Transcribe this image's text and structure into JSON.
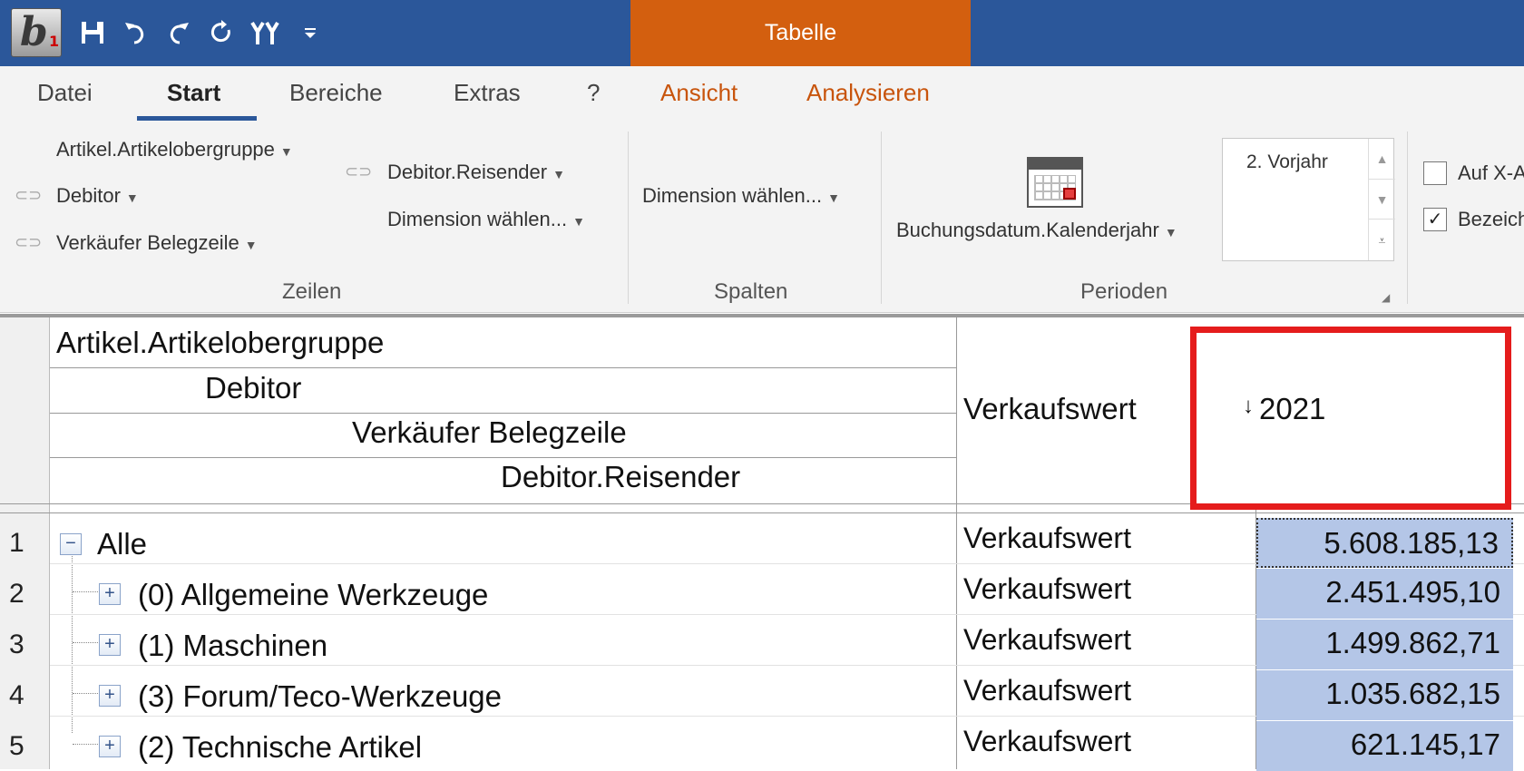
{
  "titlebar": {
    "contextual_tab": "Tabelle"
  },
  "ribbon_tabs": [
    {
      "label": "Datei"
    },
    {
      "label": "Start"
    },
    {
      "label": "Bereiche"
    },
    {
      "label": "Extras"
    },
    {
      "label": "?"
    },
    {
      "label": "Ansicht"
    },
    {
      "label": "Analysieren"
    }
  ],
  "ribbon": {
    "zeilen": {
      "label": "Zeilen",
      "items": [
        "Artikel.Artikelobergruppe",
        "Debitor",
        "Verkäufer Belegzeile",
        "Debitor.Reisender",
        "Dimension wählen..."
      ]
    },
    "spalten": {
      "label": "Spalten",
      "dimension": "Dimension wählen..."
    },
    "perioden": {
      "label": "Perioden",
      "field": "Buchungsdatum.Kalenderjahr",
      "list_item": "2. Vorjahr"
    },
    "options": {
      "checkbox1": "Auf X-A",
      "checkbox2": "Bezeich"
    }
  },
  "grid": {
    "row_headers": [
      "Artikel.Artikelobergruppe",
      "Debitor",
      "Verkäufer Belegzeile",
      "Debitor.Reisender"
    ],
    "measure_header": "Verkaufswert",
    "column_header": "2021",
    "sort_glyph": "↓",
    "rows": [
      {
        "num": "1",
        "label": "Alle",
        "measure": "Verkaufswert",
        "value": "5.608.185,13"
      },
      {
        "num": "2",
        "label": "(0) Allgemeine Werkzeuge",
        "measure": "Verkaufswert",
        "value": "2.451.495,10"
      },
      {
        "num": "3",
        "label": "(1) Maschinen",
        "measure": "Verkaufswert",
        "value": "1.499.862,71"
      },
      {
        "num": "4",
        "label": "(3) Forum/Teco-Werkzeuge",
        "measure": "Verkaufswert",
        "value": "1.035.682,15"
      },
      {
        "num": "5",
        "label": "(2) Technische Artikel",
        "measure": "Verkaufswert",
        "value": "621.145,17"
      }
    ]
  },
  "icons": [
    "app-logo",
    "save-icon",
    "undo-icon",
    "redo-icon",
    "refresh-icon",
    "tools-icon",
    "customize-icon",
    "link-icon",
    "calendar-icon"
  ]
}
